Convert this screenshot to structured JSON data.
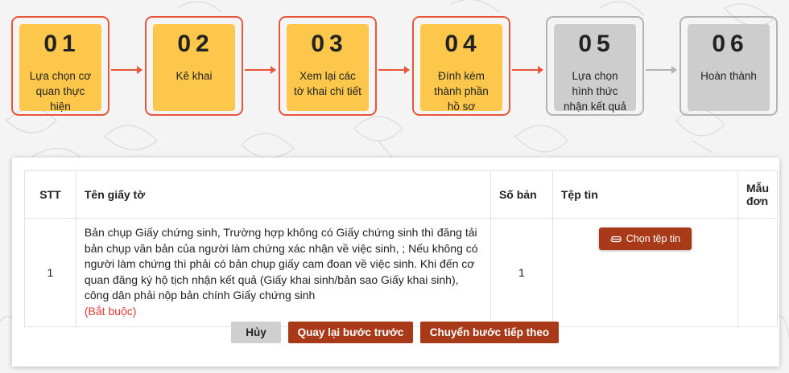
{
  "steps": [
    {
      "number": "01",
      "label": "Lựa chọn cơ quan thực hiện",
      "state": "active"
    },
    {
      "number": "02",
      "label": "Kê khai",
      "state": "active"
    },
    {
      "number": "03",
      "label": "Xem lại các tờ khai chi tiết",
      "state": "active"
    },
    {
      "number": "04",
      "label": "Đính kèm thành phần hồ sơ",
      "state": "active"
    },
    {
      "number": "05",
      "label": "Lựa chọn hình thức nhận kết quả",
      "state": "inactive"
    },
    {
      "number": "06",
      "label": "Hoàn thành",
      "state": "inactive"
    }
  ],
  "table": {
    "headers": {
      "stt": "STT",
      "name": "Tên giấy tờ",
      "copies": "Số bản",
      "file": "Tệp tin",
      "template": "Mẫu đơn"
    },
    "rows": [
      {
        "stt": "1",
        "name": "Bản chụp Giấy chứng sinh, Trường hợp không có Giấy chứng sinh thì đăng tải bản chụp văn bản của người làm chứng xác nhận về việc sinh, ; Nếu không có người làm chứng thì phải có bản chụp giấy cam đoan về việc sinh. Khi đến cơ quan đăng ký hộ tịch nhận kết quả (Giấy khai sinh/bản sao Giấy khai sinh), công dân phải nộp bản chính Giấy chứng sinh",
        "required": "(Bắt buộc)",
        "copies": "1",
        "file_button": "Chọn tệp tin",
        "template": ""
      }
    ]
  },
  "actions": {
    "cancel": "Hủy",
    "back": "Quay lại bước trước",
    "next": "Chuyển bước tiếp theo"
  },
  "colors": {
    "active_step": "#fcc74a",
    "inactive_step": "#cdcdcd",
    "accent_border": "#e8553b",
    "button": "#a83a1a",
    "required_text": "#e53935"
  },
  "icons": {
    "file_button_icon": "paperclip-icon"
  }
}
